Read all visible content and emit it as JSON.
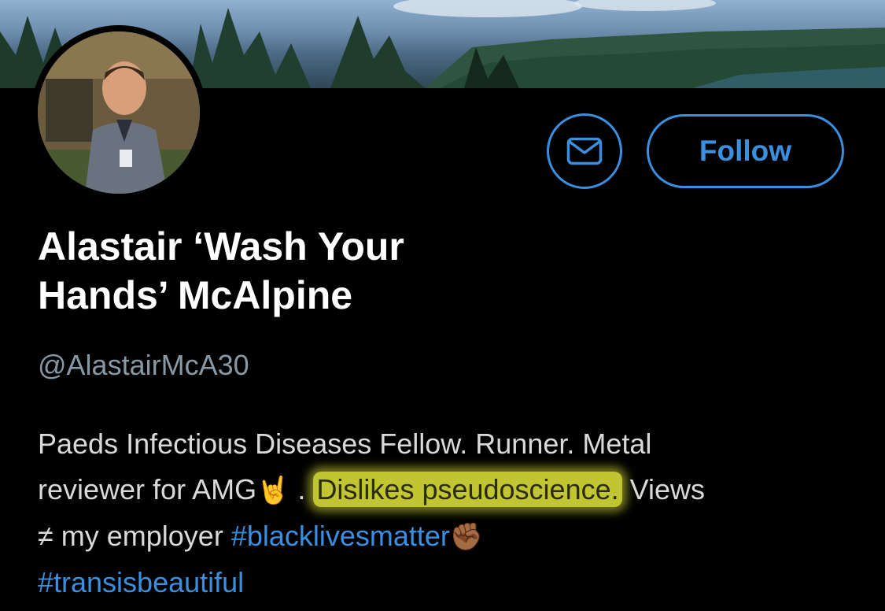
{
  "profile": {
    "display_name_line1": "Alastair ‘Wash Your",
    "display_name_line2": "Hands’ McAlpine",
    "handle": "@AlastairMcA30"
  },
  "actions": {
    "message_icon": "envelope-icon",
    "follow_label": "Follow"
  },
  "bio": {
    "line1": "Paeds Infectious Diseases Fellow. Runner. Metal",
    "line2_prefix": "reviewer for AMG",
    "line2_emoji": "🤘",
    "line2_dot": " . ",
    "line2_highlight": "Dislikes pseudoscience.",
    "line2_suffix": " Views",
    "line3_prefix": "≠ my employer ",
    "hashtag1": "#blacklivesmatter",
    "line3_emoji": "✊🏾",
    "hashtag2": "#transisbeautiful"
  },
  "colors": {
    "accent": "#3b8fe0",
    "background": "#000000",
    "handle": "#8899a6",
    "highlight": "#e2e83a"
  }
}
